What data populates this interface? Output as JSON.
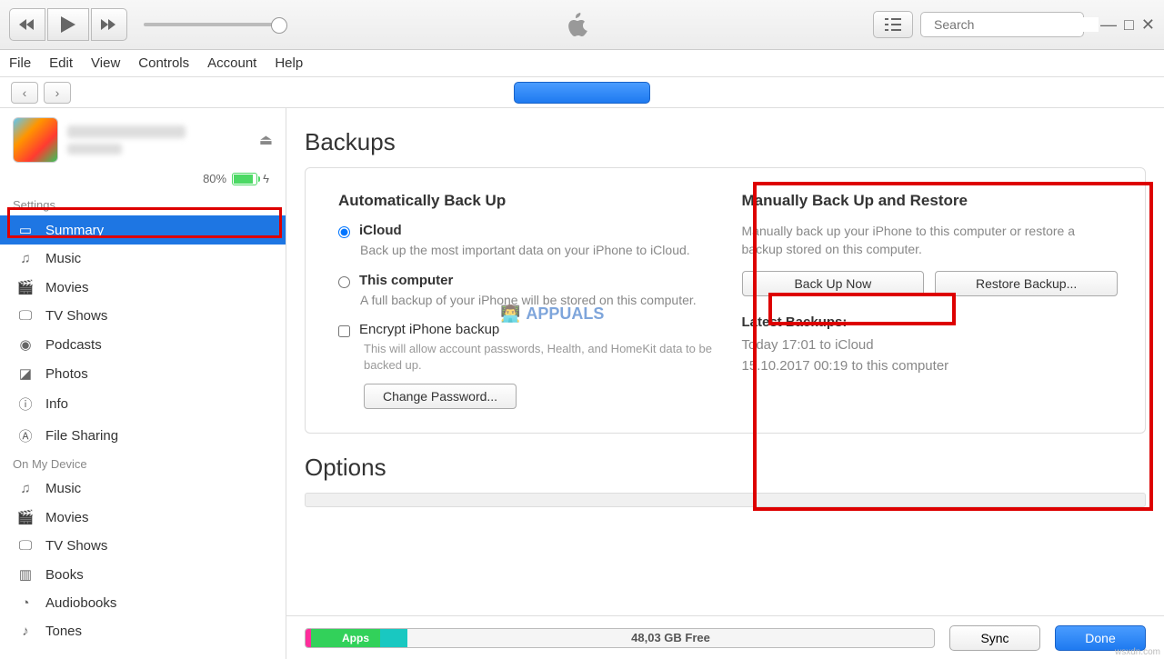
{
  "toolbar": {
    "search_placeholder": "Search"
  },
  "menubar": [
    "File",
    "Edit",
    "View",
    "Controls",
    "Account",
    "Help"
  ],
  "device": {
    "battery_pct": "80%"
  },
  "sidebar": {
    "settings_label": "Settings",
    "settings_items": [
      "Summary",
      "Music",
      "Movies",
      "TV Shows",
      "Podcasts",
      "Photos",
      "Info",
      "File Sharing"
    ],
    "device_label": "On My Device",
    "device_items": [
      "Music",
      "Movies",
      "TV Shows",
      "Books",
      "Audiobooks",
      "Tones"
    ]
  },
  "backups": {
    "title": "Backups",
    "auto_header": "Automatically Back Up",
    "icloud_label": "iCloud",
    "icloud_desc": "Back up the most important data on your iPhone to iCloud.",
    "thispc_label": "This computer",
    "thispc_desc": "A full backup of your iPhone will be stored on this computer.",
    "encrypt_label": "Encrypt iPhone backup",
    "encrypt_desc": "This will allow account passwords, Health, and HomeKit data to be backed up.",
    "change_pw": "Change Password...",
    "manual_header": "Manually Back Up and Restore",
    "manual_desc": "Manually back up your iPhone to this computer or restore a backup stored on this computer.",
    "backup_now": "Back Up Now",
    "restore": "Restore Backup...",
    "latest_header": "Latest Backups:",
    "latest_1": "Today 17:01 to iCloud",
    "latest_2": "15.10.2017 00:19 to this computer"
  },
  "options": {
    "title": "Options"
  },
  "bottom": {
    "apps_label": "Apps",
    "free_label": "48,03 GB Free",
    "sync": "Sync",
    "done": "Done"
  },
  "watermark_brand": "APPUALS",
  "watermark_domain": "wsxdn.com"
}
